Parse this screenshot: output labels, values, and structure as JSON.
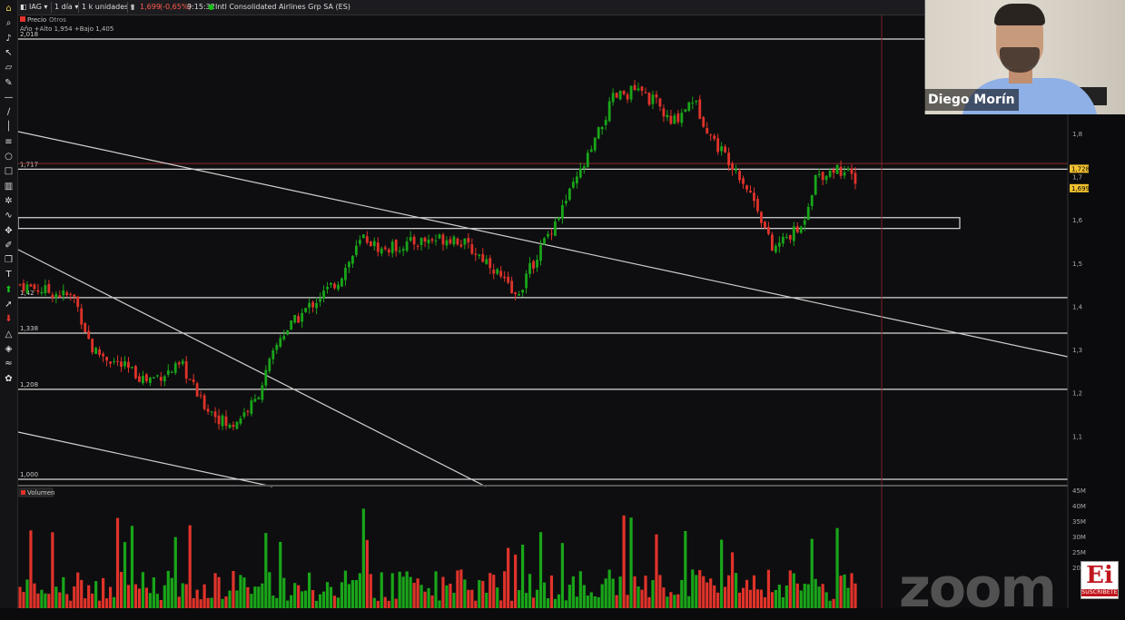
{
  "topbar": {
    "symbol": "IAG",
    "interval": "1 día",
    "units": "1 k unidades",
    "price": "1,699",
    "change": "(-0,65%)",
    "time": "9:15:32",
    "company": "Intl Consolidated Airlines Grp SA (ES)"
  },
  "chart_header": {
    "tab_price": "Precio",
    "tab_other": "Otros",
    "info": "Año +Alto 1,954 +Bajo 1,405",
    "volume_label": "Volumen"
  },
  "chart_data": {
    "type": "candlestick",
    "price_axis": {
      "min": 1.0,
      "max": 2.018,
      "ticks": [
        "1,8",
        "1,7",
        "1,6",
        "1,5",
        "1,4",
        "1,3",
        "1,2",
        "1,1"
      ]
    },
    "levels": [
      {
        "label": "2,018",
        "value": 2.018
      },
      {
        "label": "1,717",
        "value": 1.717
      },
      {
        "label": "1,42",
        "value": 1.42
      },
      {
        "label": "1,338",
        "value": 1.338
      },
      {
        "label": "1,208",
        "value": 1.208
      },
      {
        "label": "1,000",
        "value": 1.0
      }
    ],
    "zone": {
      "low": 1.58,
      "high": 1.605
    },
    "price_tags": [
      {
        "label": "1,728",
        "value": 1.717
      },
      {
        "label": "1,699",
        "value": 1.672
      }
    ],
    "volume_axis": {
      "ticks": [
        "45M",
        "40M",
        "35M",
        "30M",
        "25M",
        "20M"
      ]
    },
    "colors": {
      "up": "#19a519",
      "down": "#e0332a",
      "level": "#d8d8d8",
      "tag": "#f2c230"
    },
    "candle_count": 232
  },
  "toolbar": {
    "icons": [
      "home-icon",
      "zoom-icon",
      "bell-icon",
      "cursor-icon",
      "ruler-icon",
      "pencil-icon",
      "horizontal-line-icon",
      "trend-line-icon",
      "vertical-line-icon",
      "fibonacci-icon",
      "ellipse-icon",
      "rectangle-icon",
      "trash-icon",
      "settings-icon",
      "indicator-icon",
      "move-icon",
      "brush-icon",
      "copy-icon",
      "text-icon",
      "arrow-up-icon",
      "arrow-icon",
      "arrow-down-icon",
      "triangle-icon",
      "pattern-icon",
      "wave-icon",
      "palette-icon"
    ]
  },
  "webcam": {
    "name": "Diego Morín"
  },
  "watermark": {
    "zoom": "zoom",
    "logo": "Ei",
    "logo_sub": "SUSCRÍBETE"
  }
}
